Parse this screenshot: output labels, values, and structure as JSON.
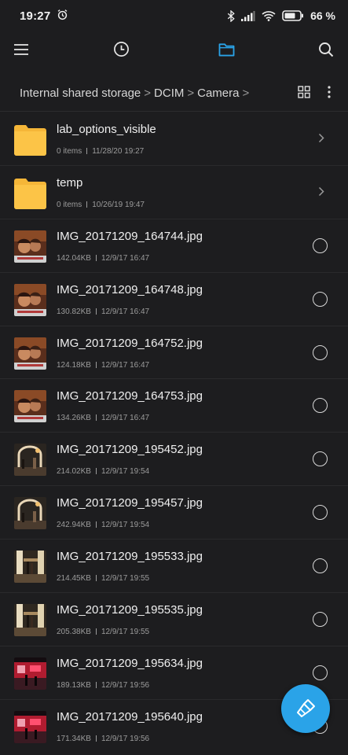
{
  "status_bar": {
    "time": "19:27",
    "battery_percent": "66 %",
    "icons": [
      "alarm-icon",
      "bluetooth-icon",
      "cellular-signal-icon",
      "wifi-icon",
      "battery-icon"
    ]
  },
  "toolbar": {
    "icons": [
      "menu-icon",
      "recent-clock-icon",
      "folder-icon",
      "search-icon"
    ],
    "active": "folder-icon",
    "accent_color": "#2aa3e8"
  },
  "breadcrumb": {
    "items": [
      "Internal shared storage",
      "DCIM",
      "Camera"
    ],
    "separator": ">",
    "actions": [
      "grid-view-icon",
      "more-options-icon"
    ]
  },
  "files": [
    {
      "name": "lab_options_visible",
      "meta_left": "0 items",
      "meta_right": "11/28/20 19:27",
      "type": "folder"
    },
    {
      "name": "temp",
      "meta_left": "0 items",
      "meta_right": "10/26/19 19:47",
      "type": "folder"
    },
    {
      "name": "IMG_20171209_164744.jpg",
      "meta_left": "142.04KB",
      "meta_right": "12/9/17 16:47",
      "type": "image",
      "thumb": "warm"
    },
    {
      "name": "IMG_20171209_164748.jpg",
      "meta_left": "130.82KB",
      "meta_right": "12/9/17 16:47",
      "type": "image",
      "thumb": "warm"
    },
    {
      "name": "IMG_20171209_164752.jpg",
      "meta_left": "124.18KB",
      "meta_right": "12/9/17 16:47",
      "type": "image",
      "thumb": "warm"
    },
    {
      "name": "IMG_20171209_164753.jpg",
      "meta_left": "134.26KB",
      "meta_right": "12/9/17 16:47",
      "type": "image",
      "thumb": "warm"
    },
    {
      "name": "IMG_20171209_195452.jpg",
      "meta_left": "214.02KB",
      "meta_right": "12/9/17 19:54",
      "type": "image",
      "thumb": "arch"
    },
    {
      "name": "IMG_20171209_195457.jpg",
      "meta_left": "242.94KB",
      "meta_right": "12/9/17 19:54",
      "type": "image",
      "thumb": "arch"
    },
    {
      "name": "IMG_20171209_195533.jpg",
      "meta_left": "214.45KB",
      "meta_right": "12/9/17 19:55",
      "type": "image",
      "thumb": "street"
    },
    {
      "name": "IMG_20171209_195535.jpg",
      "meta_left": "205.38KB",
      "meta_right": "12/9/17 19:55",
      "type": "image",
      "thumb": "street"
    },
    {
      "name": "IMG_20171209_195634.jpg",
      "meta_left": "189.13KB",
      "meta_right": "12/9/17 19:56",
      "type": "image",
      "thumb": "red"
    },
    {
      "name": "IMG_20171209_195640.jpg",
      "meta_left": "171.34KB",
      "meta_right": "12/9/17 19:56",
      "type": "image",
      "thumb": "red"
    }
  ],
  "fab": {
    "icon": "clean-brush-icon",
    "color": "#2aa3e8"
  }
}
